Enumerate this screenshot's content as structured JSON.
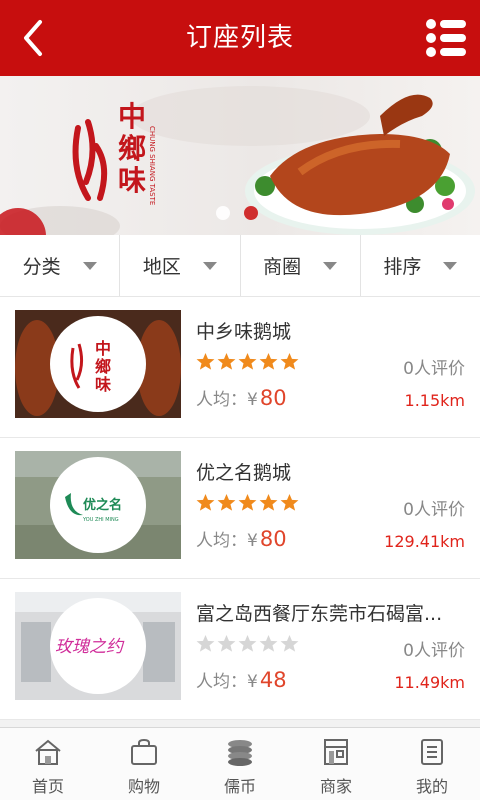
{
  "header": {
    "title": "订座列表",
    "back_icon": "back-arrow-icon",
    "menu_icon": "list-menu-icon",
    "bg_color": "#c70e0e"
  },
  "banner": {
    "logo_text": "中鄉味",
    "logo_sub": "CHUNG SHIANG TASTE",
    "slide_count": 2,
    "active_slide": 2
  },
  "filters": [
    {
      "label": "分类"
    },
    {
      "label": "地区"
    },
    {
      "label": "商圈"
    },
    {
      "label": "排序"
    }
  ],
  "restaurants": [
    {
      "name": "中乡味鹅城",
      "stars": 5,
      "reviews": "0人评价",
      "avg_label": "人均：",
      "currency": "¥",
      "price": "80",
      "distance": "1.15km",
      "logo_text": "中鄉味"
    },
    {
      "name": "优之名鹅城",
      "stars": 5,
      "reviews": "0人评价",
      "avg_label": "人均：",
      "currency": "¥",
      "price": "80",
      "distance": "129.41km",
      "logo_text": "优之名"
    },
    {
      "name": "富之岛西餐厅东莞市石碣富...",
      "stars": 0,
      "reviews": "0人评价",
      "avg_label": "人均：",
      "currency": "¥",
      "price": "48",
      "distance": "11.49km",
      "logo_text": "玫瑰之约"
    }
  ],
  "tabbar": [
    {
      "label": "首页",
      "icon": "home-icon"
    },
    {
      "label": "购物",
      "icon": "shopping-bag-icon"
    },
    {
      "label": "儒币",
      "icon": "coins-icon"
    },
    {
      "label": "商家",
      "icon": "store-icon"
    },
    {
      "label": "我的",
      "icon": "profile-icon"
    }
  ],
  "colors": {
    "accent": "#c70e0e",
    "price": "#e0452b",
    "star": "#f08a1c",
    "star_empty": "#d6d6d6"
  }
}
